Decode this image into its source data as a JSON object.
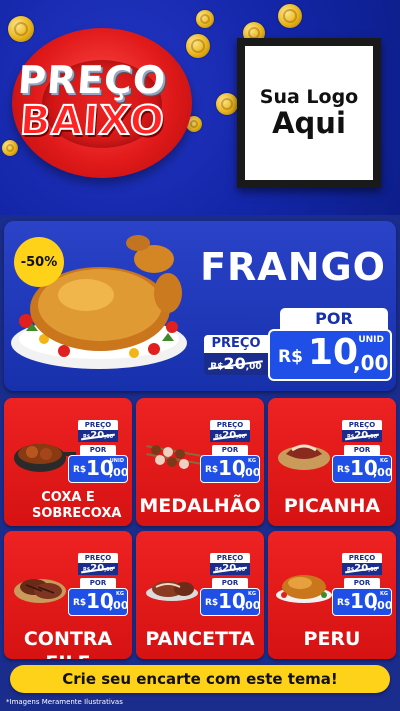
{
  "header": {
    "headline_line1": "PREÇO",
    "headline_line2": "BAIXO",
    "brand_line1": "Sua Logo",
    "brand_line2": "Aqui"
  },
  "featured": {
    "discount_badge": "-50%",
    "name": "FRANGO",
    "old_price_label": "PREÇO",
    "old_price_currency": "R$",
    "old_price_int": "20",
    "old_price_dec": ",00",
    "new_price_label": "POR",
    "new_price_currency": "R$",
    "new_price_int": "10",
    "new_price_dec": ",00",
    "unit": "UNID"
  },
  "products": [
    {
      "name": "COXA E SOBRECOXA",
      "old_label": "PREÇO",
      "old_currency": "R$",
      "old_int": "20",
      "old_dec": ",00",
      "new_label": "POR",
      "currency": "R$",
      "int": "10",
      "dec": ",00",
      "unit": "UNID"
    },
    {
      "name": "MEDALHÃO",
      "old_label": "PREÇO",
      "old_currency": "R$",
      "old_int": "20",
      "old_dec": ",00",
      "new_label": "POR",
      "currency": "R$",
      "int": "10",
      "dec": ",00",
      "unit": "KG"
    },
    {
      "name": "PICANHA",
      "old_label": "PREÇO",
      "old_currency": "R$",
      "old_int": "20",
      "old_dec": ",00",
      "new_label": "POR",
      "currency": "R$",
      "int": "10",
      "dec": ",00",
      "unit": "KG"
    },
    {
      "name": "CONTRA FILE",
      "old_label": "PREÇO",
      "old_currency": "R$",
      "old_int": "20",
      "old_dec": ",00",
      "new_label": "POR",
      "currency": "R$",
      "int": "10",
      "dec": ",00",
      "unit": "KG"
    },
    {
      "name": "PANCETTA",
      "old_label": "PREÇO",
      "old_currency": "R$",
      "old_int": "20",
      "old_dec": ",00",
      "new_label": "POR",
      "currency": "R$",
      "int": "10",
      "dec": ",00",
      "unit": "KG"
    },
    {
      "name": "PERU",
      "old_label": "PREÇO",
      "old_currency": "R$",
      "old_int": "20",
      "old_dec": ",00",
      "new_label": "POR",
      "currency": "R$",
      "int": "10",
      "dec": ",00",
      "unit": "KG"
    }
  ],
  "footer": {
    "cta": "Crie seu encarte com este tema!",
    "disclaimer": "*Imagens Meramente Ilustrativas"
  }
}
